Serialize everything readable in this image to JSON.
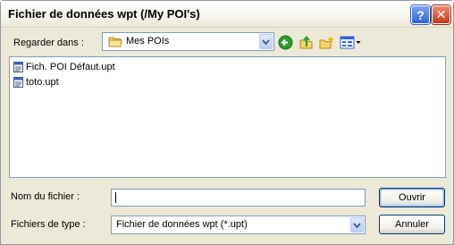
{
  "window": {
    "title": "Fichier de données wpt (/My POI's)",
    "help_glyph": "?",
    "close_glyph": "✕"
  },
  "lookin": {
    "label": "Regarder dans :",
    "value": "Mes POIs",
    "icon": "folder-icon"
  },
  "toolbar": {
    "icons": [
      "back-arrow-icon",
      "up-folder-icon",
      "new-folder-icon",
      "view-menu-icon"
    ]
  },
  "files": [
    {
      "name": "Fich. POI Défaut.upt",
      "icon": "file-icon"
    },
    {
      "name": "toto.upt",
      "icon": "file-icon"
    }
  ],
  "filename": {
    "label": "Nom du fichier :",
    "value": ""
  },
  "filetype": {
    "label": "Fichiers de type :",
    "value": "Fichier de données wpt (*.upt)"
  },
  "buttons": {
    "open": "Ouvrir",
    "cancel": "Annuler"
  },
  "colors": {
    "window_bg": "#ece9d8",
    "field_border": "#7f9db9",
    "back_icon_green": "#2e9b2e",
    "folder_yellow": "#f5d36a",
    "close_red": "#c63a1a",
    "help_blue": "#2f66d6"
  }
}
